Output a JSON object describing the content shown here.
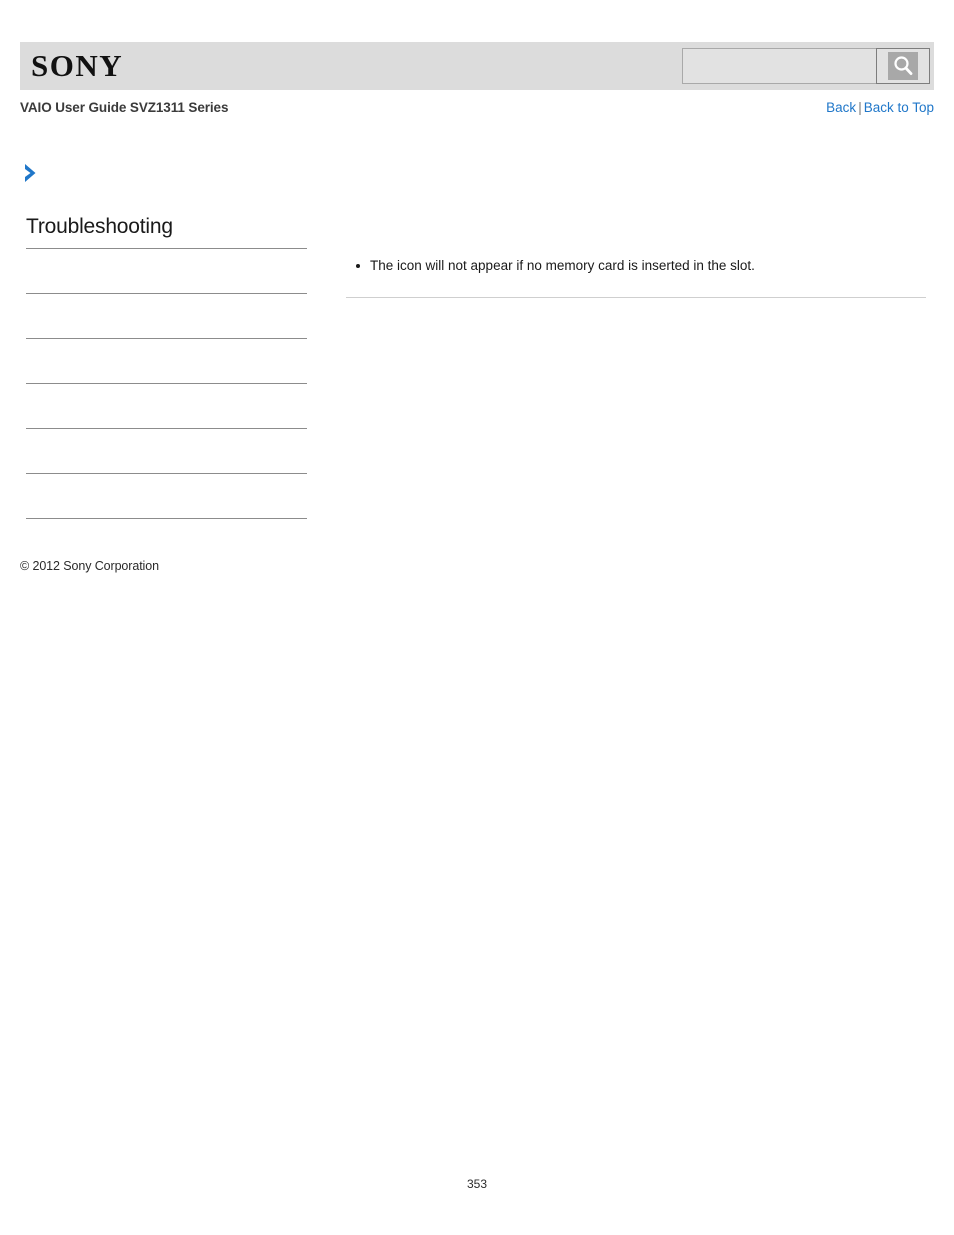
{
  "header": {
    "logo_text": "SONY",
    "search": {
      "value": "",
      "placeholder": "",
      "button_icon": "search-icon",
      "button_label": ""
    },
    "band_color": "#dcdcdc"
  },
  "subheader": {
    "guide_title": "VAIO User Guide SVZ1311 Series",
    "links": {
      "back": "Back",
      "separator": "|",
      "back_to_top": "Back to Top"
    },
    "link_color": "#2077c9"
  },
  "breadcrumb": {
    "icon": "chevron-right-icon",
    "icon_color": "#2077c9",
    "text": ""
  },
  "sidebar": {
    "title": "Troubleshooting",
    "items": [
      {
        "label": ""
      },
      {
        "label": ""
      },
      {
        "label": ""
      },
      {
        "label": ""
      },
      {
        "label": ""
      },
      {
        "label": ""
      }
    ]
  },
  "main": {
    "notes": [
      "The icon will not appear if no memory card is inserted in the slot."
    ]
  },
  "footer": {
    "copyright": "© 2012 Sony Corporation",
    "page_number": "353"
  }
}
